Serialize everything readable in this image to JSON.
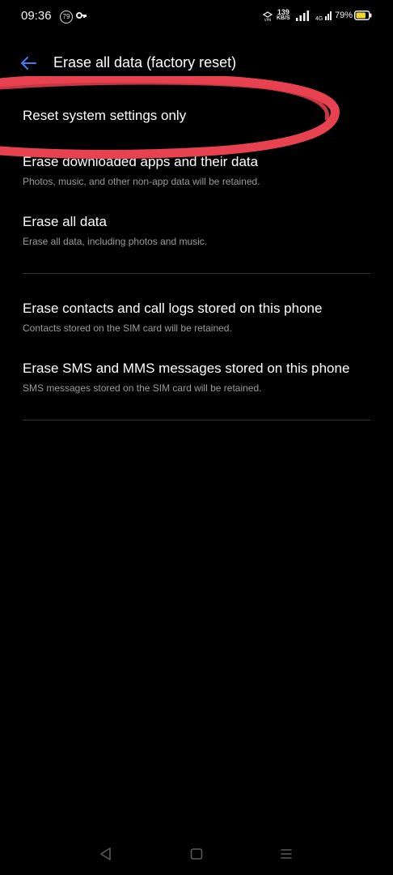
{
  "status_bar": {
    "time": "09:36",
    "notification_count": "79",
    "net_speed_value": "139",
    "net_speed_unit": "KB/S",
    "network_type": "4G",
    "battery_percent": "79%",
    "battery_level": 0.79,
    "icons": [
      "notification-badge-icon",
      "key-icon",
      "vpn-icon",
      "signal-icon",
      "lte-icon",
      "battery-icon"
    ]
  },
  "header": {
    "back_icon": "back-arrow-icon",
    "title": "Erase all data (factory reset)",
    "accent_color": "#3d7ef5"
  },
  "options": [
    {
      "title": "Reset system settings only",
      "subtitle": ""
    },
    {
      "title": "Erase downloaded apps and their data",
      "subtitle": "Photos, music, and other non-app data will be retained."
    },
    {
      "title": "Erase all data",
      "subtitle": "Erase all data, including photos and music."
    },
    {
      "title": "Erase contacts and call logs stored on this phone",
      "subtitle": "Contacts stored on the SIM card will be retained."
    },
    {
      "title": "Erase SMS and MMS messages stored on this phone",
      "subtitle": "SMS messages stored on the SIM card will be retained."
    }
  ],
  "annotation": {
    "color": "#e8414f"
  },
  "nav_bar": {
    "icons": [
      "back-triangle-icon",
      "home-square-icon",
      "menu-lines-icon"
    ]
  }
}
